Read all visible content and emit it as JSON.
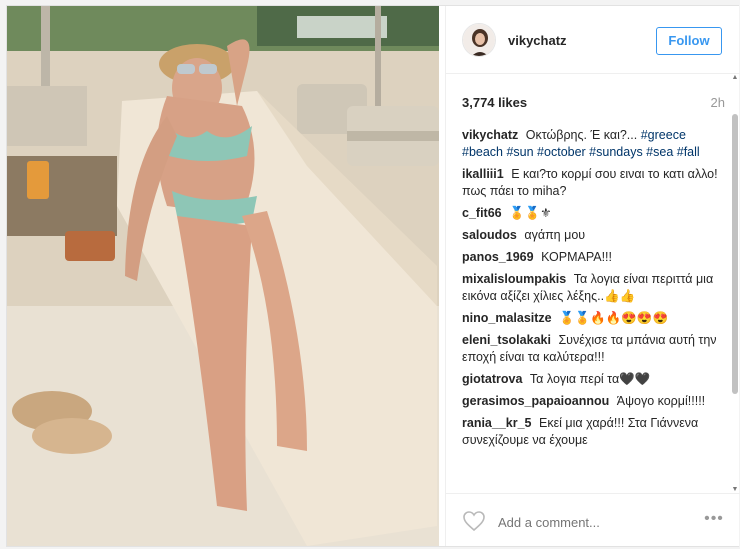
{
  "post": {
    "username": "vikychatz",
    "follow_label": "Follow",
    "likes": "3,774 likes",
    "time_ago": "2h"
  },
  "caption": {
    "username": "vikychatz",
    "text": "Οκτώβρης. Έ και?...",
    "hashtags": "#greece #beach #sun #october #sundays #sea #fall"
  },
  "comments": [
    {
      "user": "ikalliii1",
      "text": "Ε και?το κορμί σου ειναι το κατι αλλο!πως πάει το miha?"
    },
    {
      "user": "c_fit66",
      "text": "🏅🏅⚜"
    },
    {
      "user": "saloudos",
      "text": "αγάπη μου"
    },
    {
      "user": "panos_1969",
      "text": "ΚΟΡΜΑΡΑ!!!"
    },
    {
      "user": "mixalisloumpakis",
      "text": "Τα λογια είναι περιττά μια εικόνα αξίζει χίλιες λέξης..👍👍"
    },
    {
      "user": "nino_malasitze",
      "text": "🏅🏅🔥🔥😍😍😍"
    },
    {
      "user": "eleni_tsolakaki",
      "text": "Συνέχισε τα μπάνια αυτή την εποχή είναι τα καλύτερα!!!"
    },
    {
      "user": "giotatrova",
      "text": "Τα λογια περί τα🖤🖤"
    },
    {
      "user": "gerasimos_papaioannou",
      "text": "Άψογο κορμί!!!!!"
    },
    {
      "user": "rania__kr_5",
      "text": "Εκεί μια χαρά!!! Στα Γιάννενα συνεχίζουμε να έχουμε"
    }
  ],
  "footer": {
    "add_comment_placeholder": "Add a comment...",
    "more_label": "•••"
  },
  "icons": {
    "like": "heart-icon",
    "more": "more-options-icon"
  },
  "colors": {
    "accent": "#3897f0",
    "hashtag": "#003569",
    "text": "#262626",
    "muted": "#999999"
  }
}
